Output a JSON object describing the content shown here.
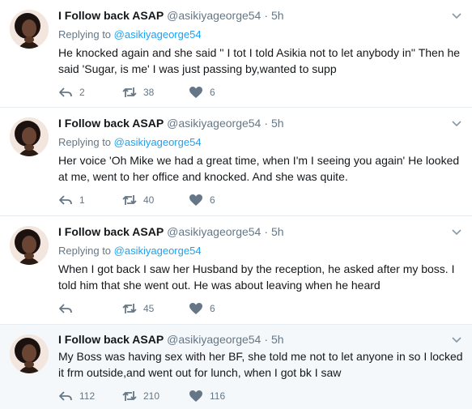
{
  "icons": {
    "reply": "reply-icon",
    "retweet": "retweet-icon",
    "like": "heart-icon",
    "more": "chevron-down-icon"
  },
  "colors": {
    "name": "#14171a",
    "meta": "#657786",
    "link": "#1da1f2",
    "divider": "#e6ecf0",
    "highlight_bg": "#f5f8fa"
  },
  "tweets": [
    {
      "name": "I Follow back ASAP",
      "handle": "@asikiyageorge54",
      "dot": "·",
      "time": "5h",
      "replying_prefix": "Replying to",
      "replying_to": "@asikiyageorge54",
      "text": "He knocked again and she said '' I tot I told Asikia not to let anybody in'' Then he said 'Sugar, is me' I was just passing by,wanted to supp",
      "replies": "2",
      "retweets": "38",
      "likes": "6"
    },
    {
      "name": "I Follow back ASAP",
      "handle": "@asikiyageorge54",
      "dot": "·",
      "time": "5h",
      "replying_prefix": "Replying to",
      "replying_to": "@asikiyageorge54",
      "text": "Her voice 'Oh Mike we had a great time, when I'm I seeing you again' He looked at me, went to her office and knocked. And she was quite.",
      "replies": "1",
      "retweets": "40",
      "likes": "6"
    },
    {
      "name": "I Follow back ASAP",
      "handle": "@asikiyageorge54",
      "dot": "·",
      "time": "5h",
      "replying_prefix": "Replying to",
      "replying_to": "@asikiyageorge54",
      "text": "When I got back I saw her Husband by the reception, he asked after my boss. I told him that she went out. He was about leaving when he heard",
      "replies": "",
      "retweets": "45",
      "likes": "6"
    },
    {
      "name": "I Follow back ASAP",
      "handle": "@asikiyageorge54",
      "dot": "·",
      "time": "5h",
      "text": "My Boss was having sex with her BF, she told me not to let anyone in so I locked it frm outside,and went out for lunch, when I got bk I saw",
      "replies": "112",
      "retweets": "210",
      "likes": "116"
    }
  ]
}
